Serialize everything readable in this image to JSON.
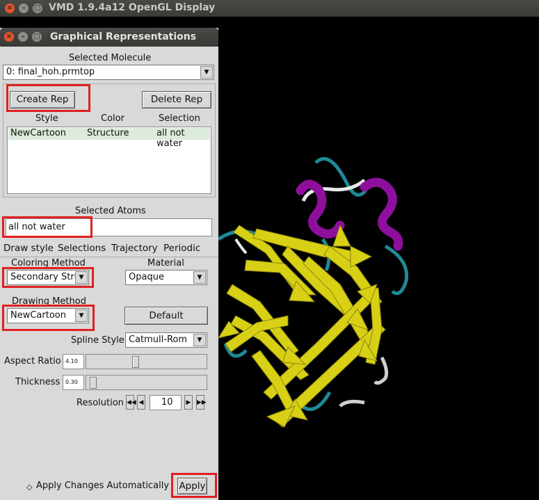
{
  "main_window": {
    "title": "VMD 1.9.4a12 OpenGL Display"
  },
  "panel": {
    "title": "Graphical Representations",
    "selected_molecule_label": "Selected Molecule",
    "selected_molecule_value": "0: final_hoh.prmtop",
    "create_rep": "Create Rep",
    "delete_rep": "Delete Rep",
    "columns": [
      "Style",
      "Color",
      "Selection"
    ],
    "rows": [
      {
        "style": "NewCartoon",
        "color": "Structure",
        "selection": "all not water"
      }
    ],
    "selected_atoms_label": "Selected Atoms",
    "selected_atoms_value": "all not water",
    "tabs": [
      "Draw style",
      "Selections",
      "Trajectory",
      "Periodic"
    ],
    "coloring_method_label": "Coloring Method",
    "coloring_method_value": "Secondary Stru",
    "material_label": "Material",
    "material_value": "Opaque",
    "drawing_method_label": "Drawing Method",
    "drawing_method_value": "NewCartoon",
    "default_button": "Default",
    "spline_style_label": "Spline Style",
    "spline_style_value": "Catmull-Rom",
    "aspect_ratio_label": "Aspect Ratio",
    "aspect_ratio_value": "4.10",
    "aspect_ratio_level": 0.4,
    "thickness_label": "Thickness",
    "thickness_value": "0.30",
    "thickness_level": 0.02,
    "resolution_label": "Resolution",
    "resolution_value": "10",
    "apply_auto_label": "Apply Changes Automatically",
    "apply_button": "Apply"
  },
  "colors": {
    "helix": "#8e0f9c",
    "sheet": "#d8d014",
    "coil": "#1f8a96",
    "turn": "#e8e8e8",
    "highlight": "#e02020"
  }
}
